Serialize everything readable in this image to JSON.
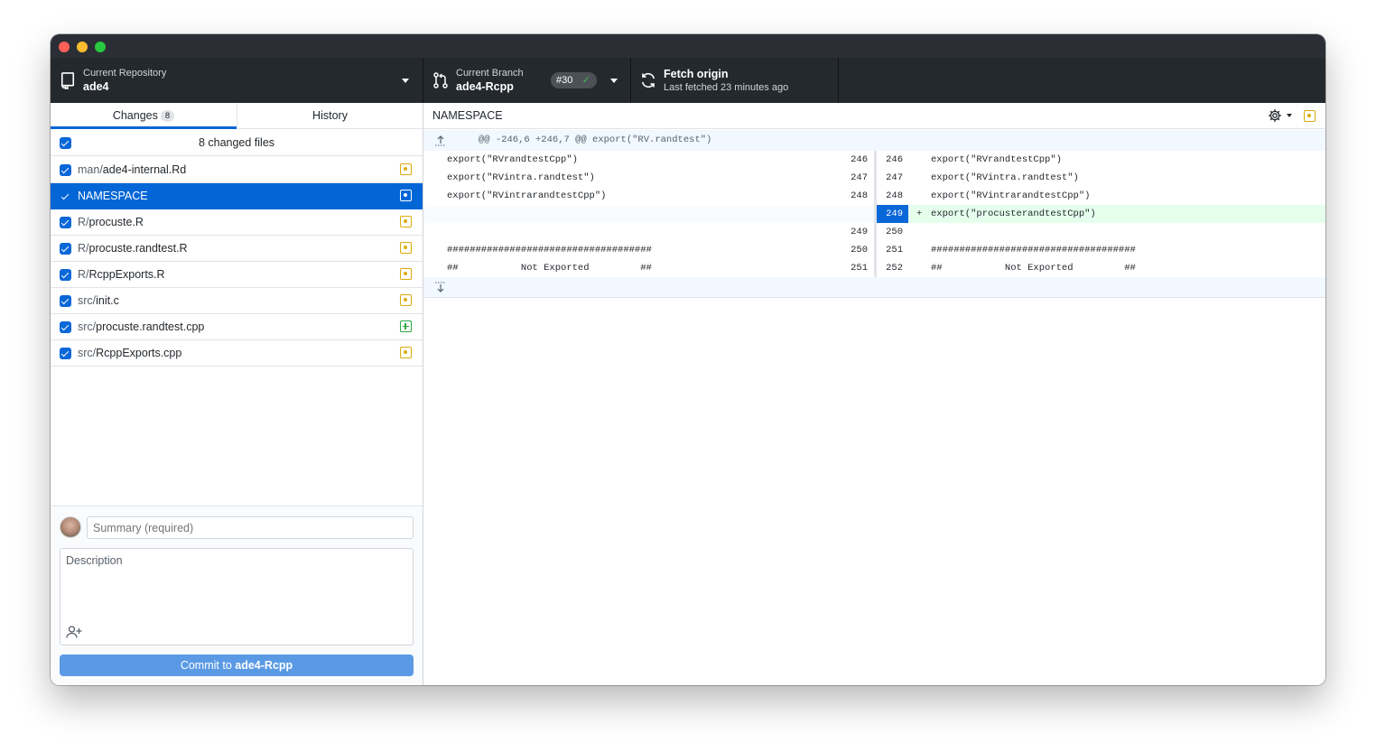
{
  "toolbar": {
    "repo_label": "Current Repository",
    "repo_name": "ade4",
    "branch_label": "Current Branch",
    "branch_name": "ade4-Rcpp",
    "pr_number": "#30",
    "fetch_title": "Fetch origin",
    "fetch_subtitle": "Last fetched 23 minutes ago"
  },
  "tabs": {
    "changes_label": "Changes",
    "changes_count": "8",
    "history_label": "History"
  },
  "changes": {
    "header_label": "8 changed files",
    "files": [
      {
        "dir": "man/",
        "name": "ade4-internal.Rd",
        "status": "modified"
      },
      {
        "dir": "",
        "name": "NAMESPACE",
        "status": "modified",
        "selected": true
      },
      {
        "dir": "R/",
        "name": "procuste.R",
        "status": "modified"
      },
      {
        "dir": "R/",
        "name": "procuste.randtest.R",
        "status": "modified"
      },
      {
        "dir": "R/",
        "name": "RcppExports.R",
        "status": "modified"
      },
      {
        "dir": "src/",
        "name": "init.c",
        "status": "modified"
      },
      {
        "dir": "src/",
        "name": "procuste.randtest.cpp",
        "status": "added"
      },
      {
        "dir": "src/",
        "name": "RcppExports.cpp",
        "status": "modified"
      }
    ]
  },
  "commit": {
    "summary_placeholder": "Summary (required)",
    "description_placeholder": "Description",
    "button_prefix": "Commit to ",
    "button_branch": "ade4-Rcpp"
  },
  "diff": {
    "filename": "NAMESPACE",
    "hunk_header": "@@ -246,6 +246,7 @@ export(\"RV.randtest\")",
    "lines": [
      {
        "left_no": "246",
        "left": "export(\"RVrandtestCpp\")",
        "right_no": "246",
        "right": "export(\"RVrandtestCpp\")"
      },
      {
        "left_no": "247",
        "left": "export(\"RVintra.randtest\")",
        "right_no": "247",
        "right": "export(\"RVintra.randtest\")"
      },
      {
        "left_no": "248",
        "left": "export(\"RVintrarandtestCpp\")",
        "right_no": "248",
        "right": "export(\"RVintrarandtestCpp\")"
      },
      {
        "left_no": "",
        "left": "",
        "right_no": "249",
        "right": "export(\"procusterandtestCpp\")",
        "added": true,
        "sign": "+"
      },
      {
        "left_no": "249",
        "left": "",
        "right_no": "250",
        "right": ""
      },
      {
        "left_no": "250",
        "left": "####################################",
        "right_no": "251",
        "right": "####################################"
      },
      {
        "left_no": "251",
        "left": "##           Not Exported         ##",
        "right_no": "252",
        "right": "##           Not Exported         ##"
      }
    ]
  },
  "colors": {
    "accent": "#0366d6",
    "toolbar_bg": "#24292e",
    "modified": "#dbab09",
    "added": "#28a745",
    "added_bg": "#e6ffed"
  }
}
